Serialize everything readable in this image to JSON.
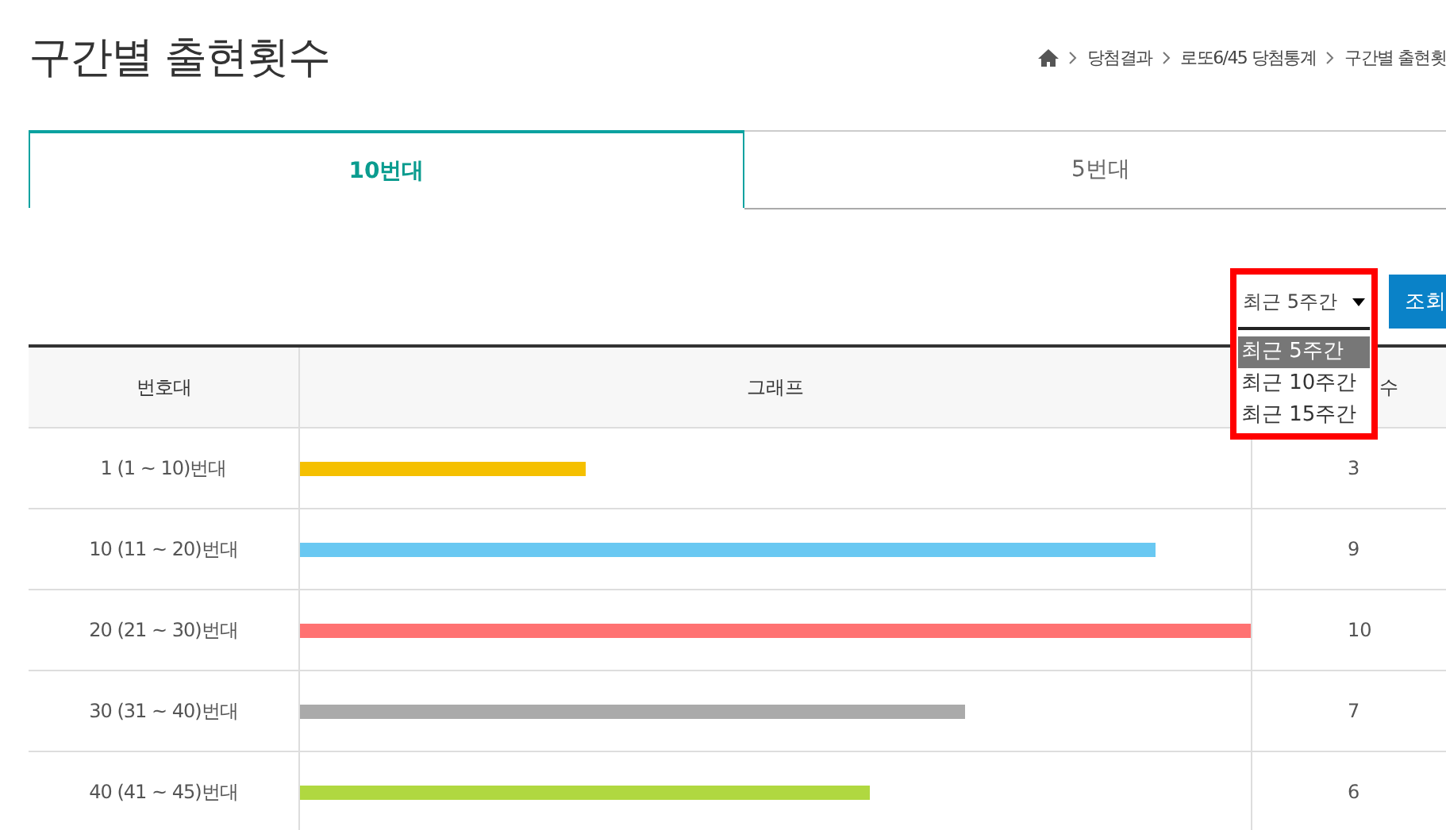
{
  "page_title": "구간별 출현횟수",
  "breadcrumb": [
    "당첨결과",
    "로또6/45 당첨통계",
    "구간별 출현횟"
  ],
  "tabs": [
    {
      "label": "10번대",
      "selected": true
    },
    {
      "label": "5번대",
      "selected": false
    }
  ],
  "period_select": {
    "value": "최근 5주간",
    "expanded": true,
    "options": [
      {
        "label": "최근 5주간",
        "selected": true
      },
      {
        "label": "최근 10주간",
        "selected": false
      },
      {
        "label": "최근 15주간",
        "selected": false
      }
    ]
  },
  "search_button": "조회",
  "table": {
    "columns": [
      "번호대",
      "그래프",
      "수"
    ],
    "rows": [
      {
        "range": "1 (1 ~ 10)번대",
        "level": 0.3,
        "color": "#f5c000",
        "count": "3"
      },
      {
        "range": "10 (11 ~ 20)번대",
        "level": 0.9,
        "color": "#69c8f2",
        "count": "9"
      },
      {
        "range": "20 (21 ~ 30)번대",
        "level": 1.0,
        "color": "#ff7272",
        "count": "10"
      },
      {
        "range": "30 (31 ~ 40)번대",
        "level": 0.7,
        "color": "#aaaaaa",
        "count": "7"
      },
      {
        "range": "40 (41 ~ 45)번대",
        "level": 0.6,
        "color": "#b0d840",
        "count": "6"
      }
    ]
  }
}
